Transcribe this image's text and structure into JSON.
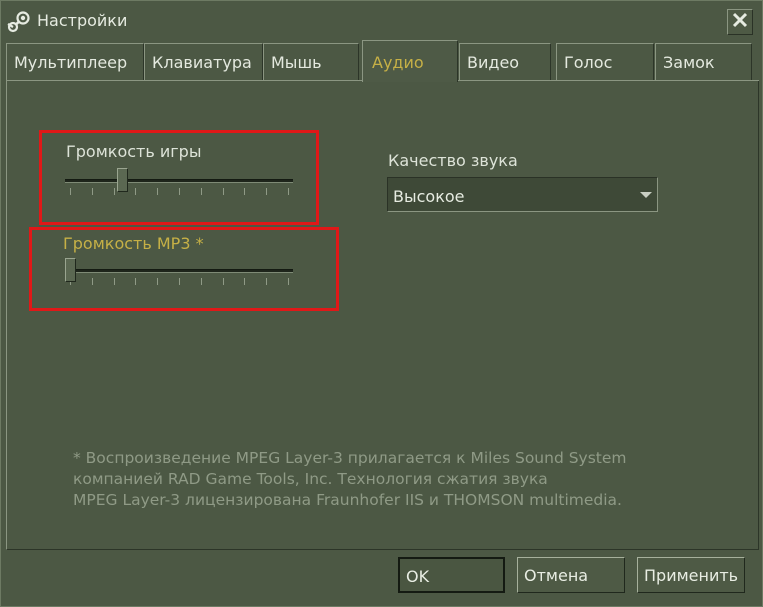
{
  "window": {
    "title": "Настройки",
    "icon": "steam-logo-icon",
    "close_icon": "close-icon"
  },
  "tabs": [
    {
      "label": "Мультиплеер",
      "active": false
    },
    {
      "label": "Клавиатура",
      "active": false
    },
    {
      "label": "Мышь",
      "active": false
    },
    {
      "label": "Аудио",
      "active": true
    },
    {
      "label": "Видео",
      "active": false
    },
    {
      "label": "Голос",
      "active": false
    },
    {
      "label": "Замок",
      "active": false
    }
  ],
  "audio": {
    "game_volume": {
      "label": "Громкость игры",
      "value_fraction": 0.24
    },
    "mp3_volume": {
      "label": "Громкость MP3 *",
      "value_fraction": 0.0
    },
    "sound_quality": {
      "label": "Качество звука",
      "selected": "Высокое"
    },
    "footnote": [
      "* Воспроизведение MPEG Layer-3 прилагается к Miles Sound System",
      "компанией RAD Game Tools, Inc. Технология сжатия звука",
      "MPEG Layer-3 лицензирована Fraunhofer IIS и THOMSON multimedia."
    ]
  },
  "buttons": {
    "ok": "OK",
    "cancel": "Отмена",
    "apply": "Применить"
  },
  "colors": {
    "background": "#4c5844",
    "active_tab_text": "#c6b046",
    "highlight_border": "#e01818"
  }
}
